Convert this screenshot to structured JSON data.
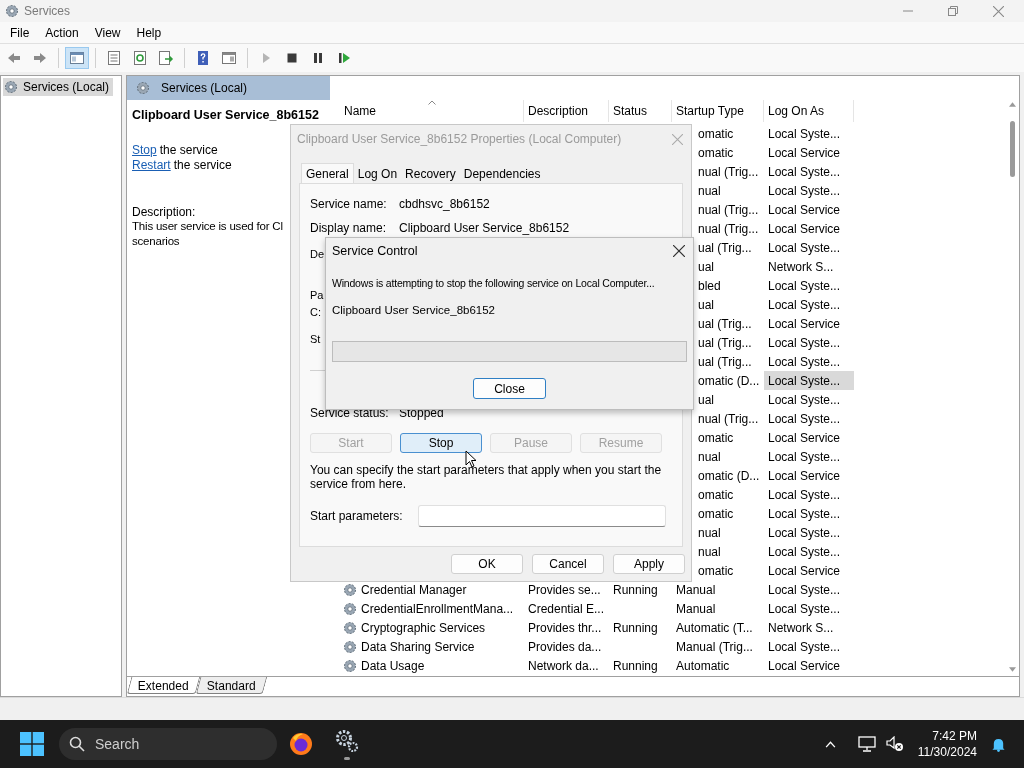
{
  "window": {
    "title": "Services"
  },
  "menu": [
    "File",
    "Action",
    "View",
    "Help"
  ],
  "toolbar": [
    [
      {
        "kind": "back",
        "pressed": false,
        "disabled": false
      },
      {
        "kind": "forward",
        "pressed": false,
        "disabled": false
      }
    ],
    [
      {
        "kind": "tree",
        "pressed": true,
        "disabled": false
      }
    ],
    [
      {
        "kind": "properties",
        "pressed": false,
        "disabled": false
      },
      {
        "kind": "refresh",
        "pressed": false,
        "disabled": false
      },
      {
        "kind": "export",
        "pressed": false,
        "disabled": false
      }
    ],
    [
      {
        "kind": "help",
        "pressed": false,
        "disabled": false
      },
      {
        "kind": "view",
        "pressed": false,
        "disabled": false
      }
    ],
    [
      {
        "kind": "play",
        "pressed": false,
        "disabled": true
      },
      {
        "kind": "stop",
        "pressed": false,
        "disabled": false
      },
      {
        "kind": "pause",
        "pressed": false,
        "disabled": false
      },
      {
        "kind": "resume",
        "pressed": false,
        "disabled": false
      }
    ]
  ],
  "tree": [
    {
      "label": "Services (Local)",
      "selected": true
    }
  ],
  "detail": {
    "header": "Services (Local)",
    "title": "Clipboard User Service_8b6152",
    "actions": [
      {
        "link": "Stop",
        "text": "the service"
      },
      {
        "link": "Restart",
        "text": "the service"
      }
    ],
    "description_label": "Description:",
    "description_lines": [
      "This user service is used for Cl",
      "scenarios"
    ]
  },
  "table": {
    "columns": [
      {
        "label": "Name",
        "sorted": true
      },
      {
        "label": "Description",
        "sorted": false
      },
      {
        "label": "Status",
        "sorted": false
      },
      {
        "label": "Startup Type",
        "sorted": false
      },
      {
        "label": "Log On As",
        "sorted": false
      }
    ],
    "rows": [
      {
        "startup": "omatic",
        "logon": "Local Syste...",
        "selected": false
      },
      {
        "startup": "omatic",
        "logon": "Local Service",
        "selected": false
      },
      {
        "startup": "nual (Trig...",
        "logon": "Local Syste...",
        "selected": false
      },
      {
        "startup": "nual",
        "logon": "Local Syste...",
        "selected": false
      },
      {
        "startup": "nual (Trig...",
        "logon": "Local Service",
        "selected": false
      },
      {
        "startup": "nual (Trig...",
        "logon": "Local Service",
        "selected": false
      },
      {
        "startup": "ual (Trig...",
        "logon": "Local Syste...",
        "selected": false
      },
      {
        "startup": "ual",
        "logon": "Network S...",
        "selected": false
      },
      {
        "startup": "bled",
        "logon": "Local Syste...",
        "selected": false
      },
      {
        "startup": "ual",
        "logon": "Local Syste...",
        "selected": false
      },
      {
        "startup": "ual (Trig...",
        "logon": "Local Service",
        "selected": false
      },
      {
        "startup": "ual (Trig...",
        "logon": "Local Syste...",
        "selected": false
      },
      {
        "startup": "ual (Trig...",
        "logon": "Local Syste...",
        "selected": false
      },
      {
        "startup": "omatic (D...",
        "logon": "Local Syste...",
        "selected": true
      },
      {
        "startup": "ual",
        "logon": "Local Syste...",
        "selected": false
      },
      {
        "startup": "nual (Trig...",
        "logon": "Local Syste...",
        "selected": false
      },
      {
        "startup": "omatic",
        "logon": "Local Service",
        "selected": false
      },
      {
        "startup": "nual",
        "logon": "Local Syste...",
        "selected": false
      },
      {
        "startup": "omatic (D...",
        "logon": "Local Service",
        "selected": false
      },
      {
        "startup": "omatic",
        "logon": "Local Syste...",
        "selected": false
      },
      {
        "startup": "omatic",
        "logon": "Local Syste...",
        "selected": false
      },
      {
        "startup": "nual",
        "logon": "Local Syste...",
        "selected": false
      },
      {
        "startup": "nual",
        "logon": "Local Syste...",
        "selected": false
      },
      {
        "startup": "omatic",
        "logon": "Local Service",
        "selected": false
      },
      {
        "name": "Credential Manager",
        "description": "Provides se...",
        "status": "Running",
        "startup": "Manual",
        "logon": "Local Syste...",
        "selected": false
      },
      {
        "name": "CredentialEnrollmentMana...",
        "description": "Credential E...",
        "startup": "Manual",
        "logon": "Local Syste...",
        "selected": false
      },
      {
        "name": "Cryptographic Services",
        "description": "Provides thr...",
        "status": "Running",
        "startup": "Automatic (T...",
        "logon": "Network S...",
        "selected": false
      },
      {
        "name": "Data Sharing Service",
        "description": "Provides da...",
        "startup": "Manual (Trig...",
        "logon": "Local Syste...",
        "selected": false
      },
      {
        "name": "Data Usage",
        "description": "Network da...",
        "status": "Running",
        "startup": "Automatic",
        "logon": "Local Service",
        "selected": false
      }
    ]
  },
  "view_tabs": [
    {
      "label": "Extended",
      "selected": true
    },
    {
      "label": "Standard",
      "selected": false
    }
  ],
  "properties_dialog": {
    "title": "Clipboard User Service_8b6152 Properties (Local Computer)",
    "active": false,
    "tabs": [
      {
        "label": "General",
        "selected": true
      },
      {
        "label": "Log On",
        "selected": false
      },
      {
        "label": "Recovery",
        "selected": false
      },
      {
        "label": "Dependencies",
        "selected": false
      }
    ],
    "fields": [
      {
        "label": "Service name:",
        "value": "cbdhsvc_8b6152"
      },
      {
        "label": "Display name:",
        "value": "Clipboard User Service_8b6152"
      }
    ],
    "covered_labels": [
      "De",
      "Pa",
      "C:",
      "St"
    ],
    "status_label": "Service status:",
    "status_value": "Stopped",
    "control_buttons": [
      {
        "label": "Start",
        "disabled": true,
        "focused": false
      },
      {
        "label": "Stop",
        "disabled": false,
        "focused": true
      },
      {
        "label": "Pause",
        "disabled": true,
        "focused": false
      },
      {
        "label": "Resume",
        "disabled": true,
        "focused": false
      }
    ],
    "hint": "You can specify the start parameters that apply when you start the service from here.",
    "start_parameters_label": "Start parameters:",
    "buttons": [
      "OK",
      "Cancel",
      "Apply"
    ]
  },
  "service_control": {
    "title": "Service Control",
    "message": "Windows is attempting to stop the following service on Local Computer...",
    "service": "Clipboard User Service_8b6152",
    "level": 0,
    "button": "Close"
  },
  "taskbar": {
    "search_placeholder": "Search",
    "time": "7:42 PM",
    "date": "11/30/2024"
  }
}
